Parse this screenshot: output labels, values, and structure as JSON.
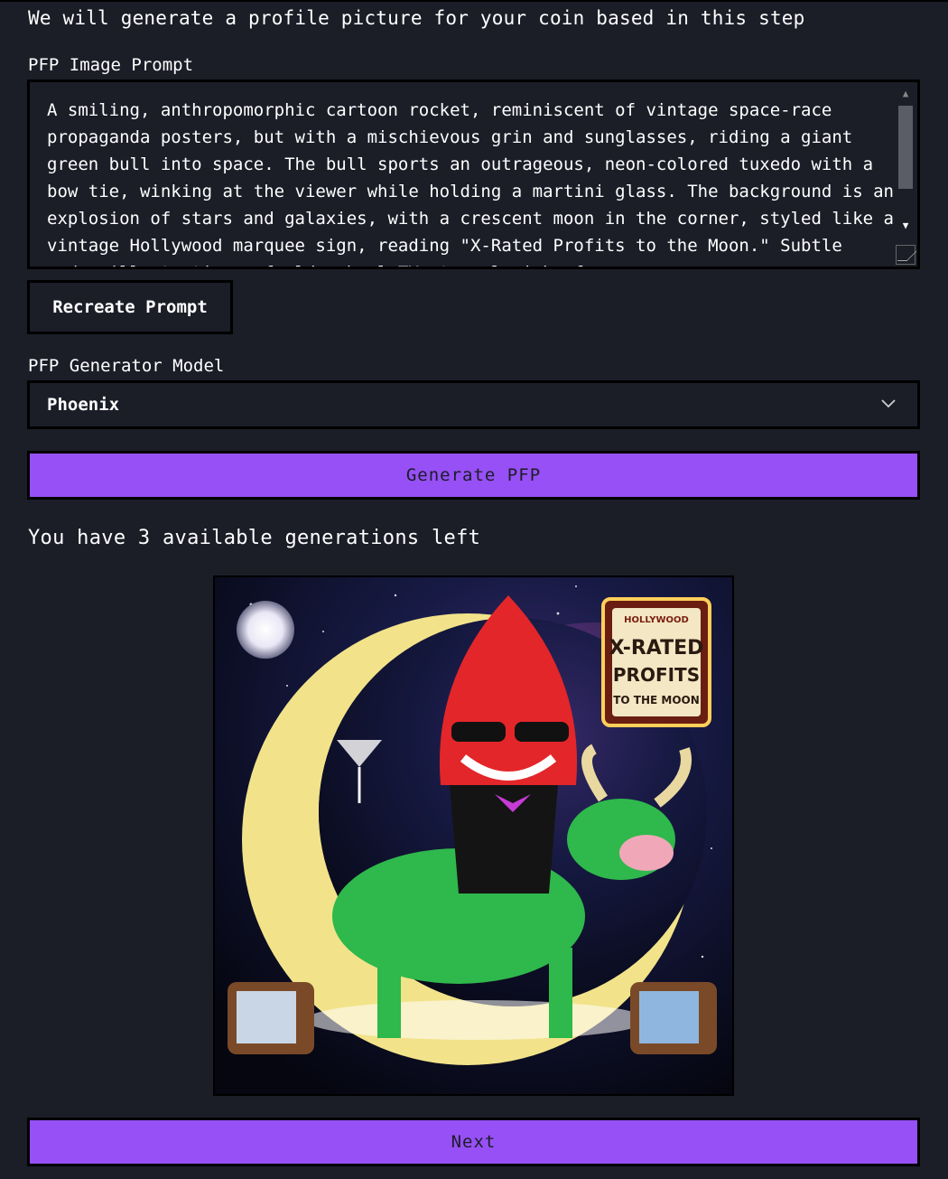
{
  "intro": "We will generate a profile picture for your coin based in this step",
  "prompt": {
    "label": "PFP Image Prompt",
    "value": "A smiling, anthropomorphic cartoon rocket, reminiscent of vintage space-race propaganda posters, but with a mischievous grin and sunglasses, riding a giant green bull into space. The bull sports an outrageous, neon-colored tuxedo with a bow tie, winking at the viewer while holding a martini glass. The background is an explosion of stars and galaxies, with a crescent moon in the corner, styled like a vintage Hollywood marquee sign, reading \"X-Rated Profits to the Moon.\" Subtle nods: illustrations of old-school TVs to a lavish, f..."
  },
  "recreate_button": "Recreate Prompt",
  "model": {
    "label": "PFP Generator Model",
    "selected": "Phoenix"
  },
  "generate_button": "Generate PFP",
  "generations_text": "You have 3 available generations left",
  "image": {
    "sign_line1": "HOLLYWOOD",
    "sign_line2": "X-RATED",
    "sign_line3": "PROFITS",
    "sign_line4": "TO THE MOON"
  },
  "next_button": "Next",
  "colors": {
    "background": "#1b1d27",
    "accent": "#9750f5",
    "border": "#000000"
  },
  "icons": [
    "chevron-down-icon",
    "scroll-up-icon",
    "scroll-down-icon",
    "resize-grip-icon"
  ]
}
